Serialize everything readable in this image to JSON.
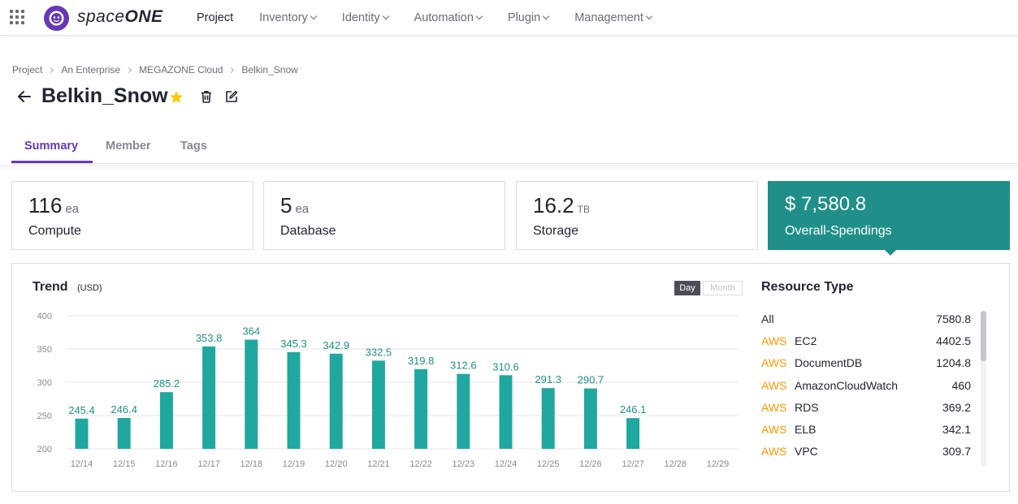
{
  "nav": {
    "logo_prefix": "space",
    "logo_suffix": "ONE",
    "menu": [
      {
        "label": "Project",
        "dropdown": false
      },
      {
        "label": "Inventory",
        "dropdown": true
      },
      {
        "label": "Identity",
        "dropdown": true
      },
      {
        "label": "Automation",
        "dropdown": true
      },
      {
        "label": "Plugin",
        "dropdown": true
      },
      {
        "label": "Management",
        "dropdown": true
      }
    ]
  },
  "breadcrumb": [
    "Project",
    "An Enterprise",
    "MEGAZONE Cloud",
    "Belkin_Snow"
  ],
  "title": "Belkin_Snow",
  "tabs": [
    "Summary",
    "Member",
    "Tags"
  ],
  "cards": [
    {
      "value": "116",
      "unit": "ea",
      "label": "Compute"
    },
    {
      "value": "5",
      "unit": "ea",
      "label": "Database"
    },
    {
      "value": "16.2",
      "unit": "TB",
      "label": "Storage"
    },
    {
      "value": "$ 7,580.8",
      "label": "Overall-Spendings"
    }
  ],
  "trend": {
    "title": "Trend",
    "unit": "(USD)",
    "toggle_day": "Day",
    "toggle_month": "Month"
  },
  "chart_data": {
    "type": "bar",
    "title": "Trend",
    "ylabel": "(USD)",
    "categories": [
      "12/14",
      "12/15",
      "12/16",
      "12/17",
      "12/18",
      "12/19",
      "12/20",
      "12/21",
      "12/22",
      "12/23",
      "12/24",
      "12/25",
      "12/26",
      "12/27",
      "12/28",
      "12/29"
    ],
    "values": [
      245.4,
      246.4,
      285.2,
      353.8,
      364,
      345.3,
      342.9,
      332.5,
      319.8,
      312.6,
      310.6,
      291.3,
      290.7,
      246.1,
      null,
      null
    ],
    "labels": [
      "245.4",
      "246.4",
      "285.2",
      "353.8",
      "364",
      "345.3",
      "342.9",
      "332.5",
      "319.8",
      "312.6",
      "310.6",
      "291.3",
      "290.7",
      "246.1",
      "",
      ""
    ],
    "ylim": [
      200,
      400
    ],
    "yticks": [
      200,
      250,
      300,
      350,
      400
    ],
    "grid": true,
    "bar_color": "#20a8a0",
    "label_color": "#208f89"
  },
  "resource_type": {
    "title": "Resource Type",
    "items": [
      {
        "provider": "",
        "name": "All",
        "value": "7580.8"
      },
      {
        "provider": "AWS",
        "name": "EC2",
        "value": "4402.5"
      },
      {
        "provider": "AWS",
        "name": "DocumentDB",
        "value": "1204.8"
      },
      {
        "provider": "AWS",
        "name": "AmazonCloudWatch",
        "value": "460"
      },
      {
        "provider": "AWS",
        "name": "RDS",
        "value": "369.2"
      },
      {
        "provider": "AWS",
        "name": "ELB",
        "value": "342.1"
      },
      {
        "provider": "AWS",
        "name": "VPC",
        "value": "309.7"
      }
    ]
  },
  "colors": {
    "brand": "#6638b6",
    "spend_card": "#208f89",
    "aws": "#ff9900"
  }
}
